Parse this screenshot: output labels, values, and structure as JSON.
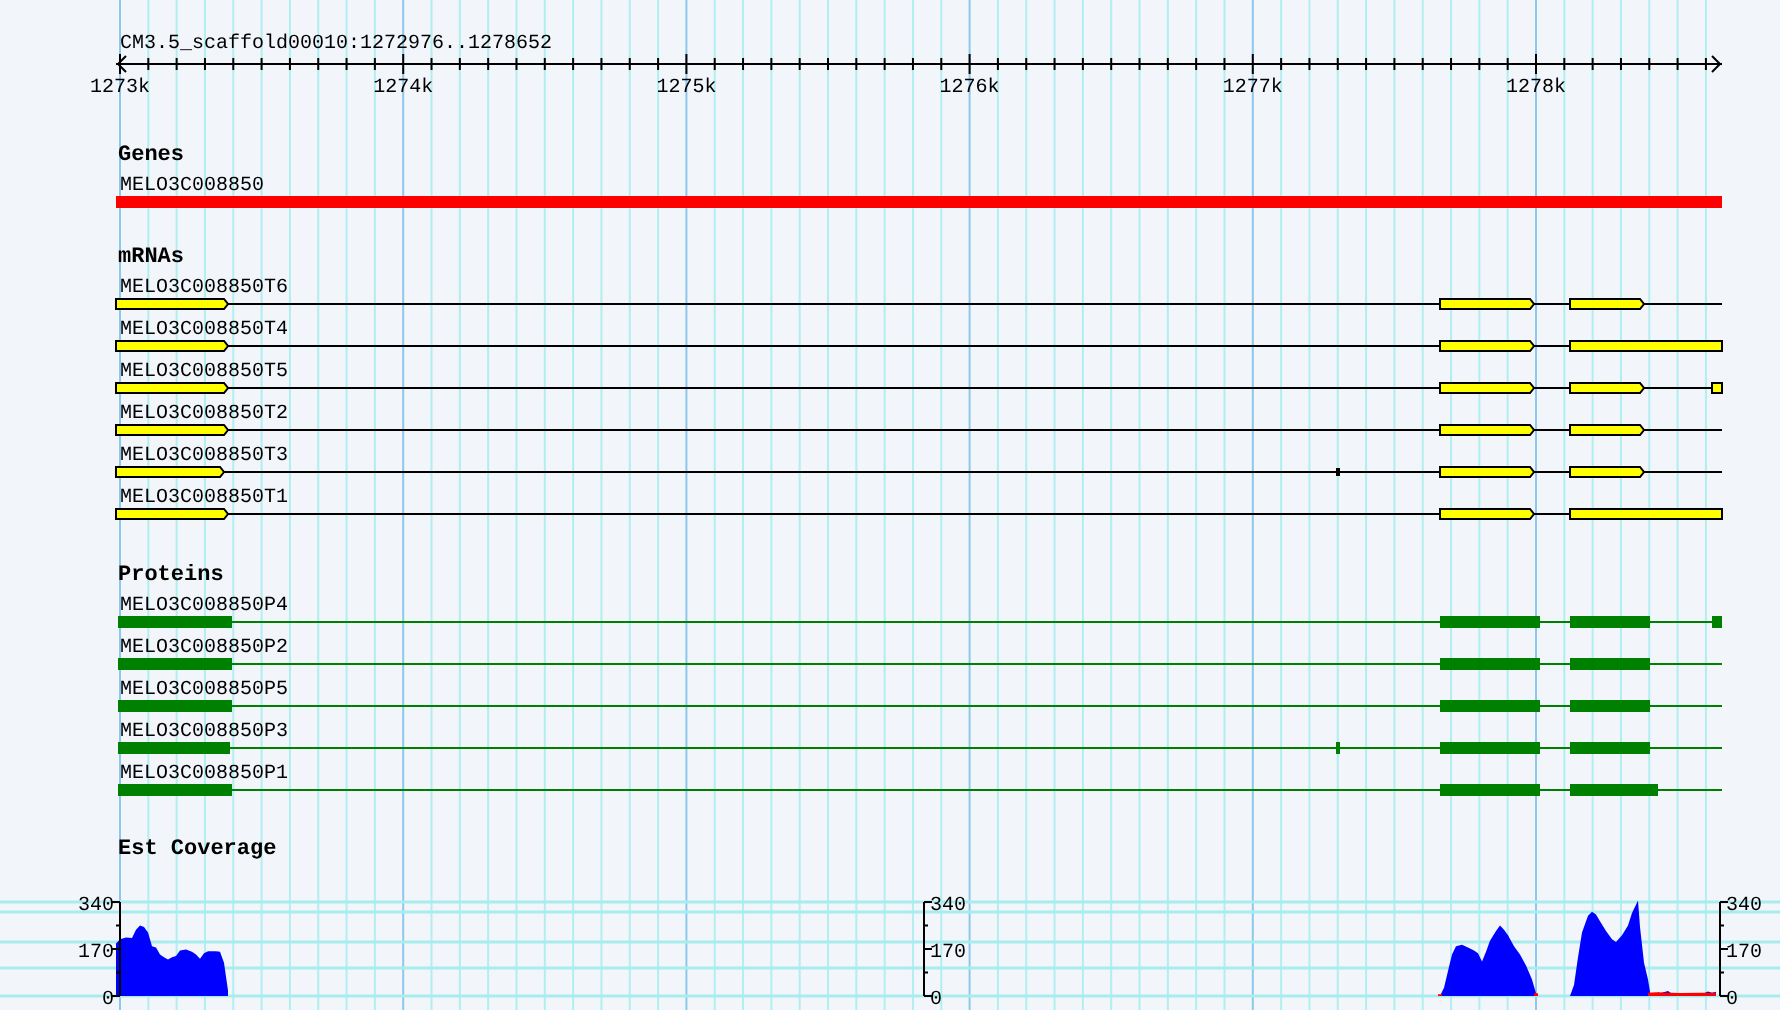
{
  "ruler": {
    "title": "CM3.5_scaffold00010:1272976..1278652",
    "ticks": [
      "1273k",
      "1274k",
      "1275k",
      "1276k",
      "1277k",
      "1278k"
    ]
  },
  "tracks": [
    {
      "title": "Genes",
      "kind": "gene",
      "features": [
        {
          "name": "MELO3C008850"
        }
      ]
    },
    {
      "title": "mRNAs",
      "kind": "mrna",
      "features": [
        {
          "name": "MELO3C008850T6"
        },
        {
          "name": "MELO3C008850T4"
        },
        {
          "name": "MELO3C008850T5"
        },
        {
          "name": "MELO3C008850T2"
        },
        {
          "name": "MELO3C008850T3"
        },
        {
          "name": "MELO3C008850T1"
        }
      ]
    },
    {
      "title": "Proteins",
      "kind": "protein",
      "features": [
        {
          "name": "MELO3C008850P4"
        },
        {
          "name": "MELO3C008850P2"
        },
        {
          "name": "MELO3C008850P5"
        },
        {
          "name": "MELO3C008850P3"
        },
        {
          "name": "MELO3C008850P1"
        }
      ]
    },
    {
      "title": "Est Coverage",
      "kind": "coverage",
      "axes": [
        {
          "labels": [
            "340",
            "170",
            "0"
          ]
        },
        {
          "labels": [
            "340",
            "170",
            "0"
          ]
        },
        {
          "labels": [
            "340",
            "170",
            "0"
          ]
        }
      ]
    }
  ]
}
